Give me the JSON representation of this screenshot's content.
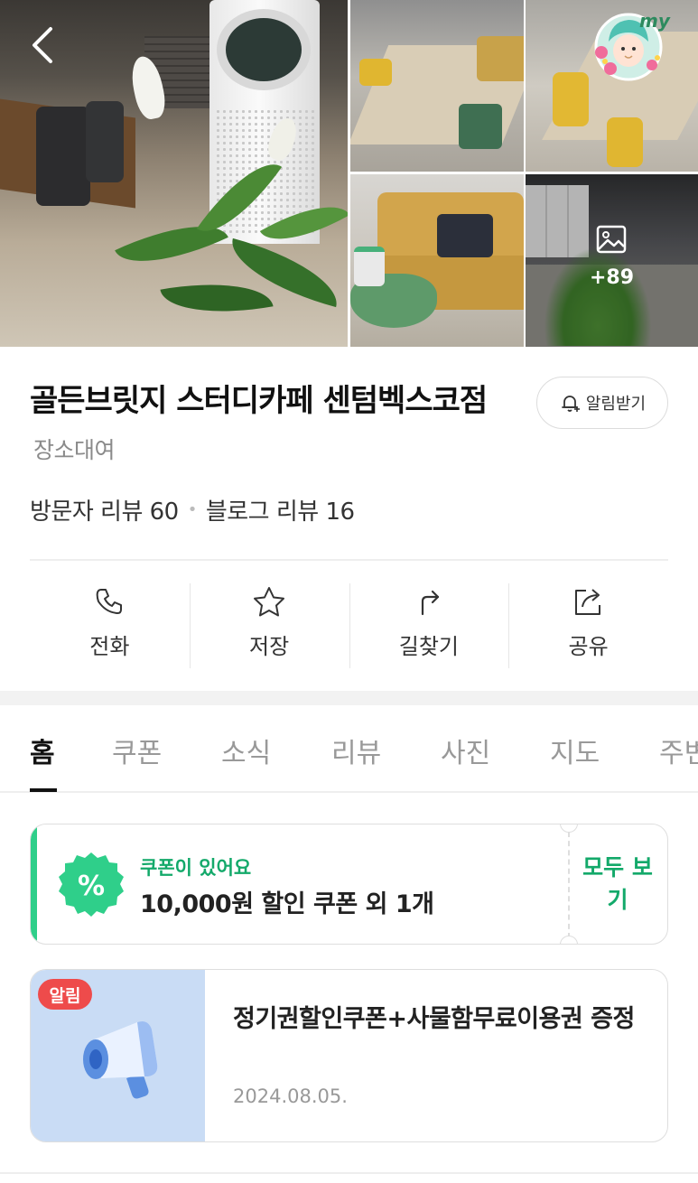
{
  "gallery": {
    "more_count": "+89",
    "badge_text": "my"
  },
  "place": {
    "name": "골든브릿지 스터디카페 센텀벡스코점",
    "category": "장소대여",
    "alarm_label": "알림받기",
    "visitor_reviews": "방문자 리뷰 60",
    "blog_reviews": "블로그 리뷰 16",
    "separator": "•"
  },
  "actions": [
    {
      "label": "전화",
      "icon": "phone-icon"
    },
    {
      "label": "저장",
      "icon": "star-icon"
    },
    {
      "label": "길찾기",
      "icon": "directions-icon"
    },
    {
      "label": "공유",
      "icon": "share-icon"
    }
  ],
  "tabs": [
    "홈",
    "쿠폰",
    "소식",
    "리뷰",
    "사진",
    "지도",
    "주변"
  ],
  "coupon": {
    "subtitle": "쿠폰이 있어요",
    "title": "10,000원 할인 쿠폰 외 1개",
    "view_all": "모두 보기",
    "badge_symbol": "%"
  },
  "notice": {
    "tag": "알림",
    "title": "정기권할인쿠폰+사물함무료이용권 증정",
    "date": "2024.08.05."
  },
  "colors": {
    "accent_green": "#13a96a",
    "coupon_strip": "#2fcf8a",
    "notice_tag": "#ee4b4b",
    "notice_bg": "#c9dcf5"
  }
}
